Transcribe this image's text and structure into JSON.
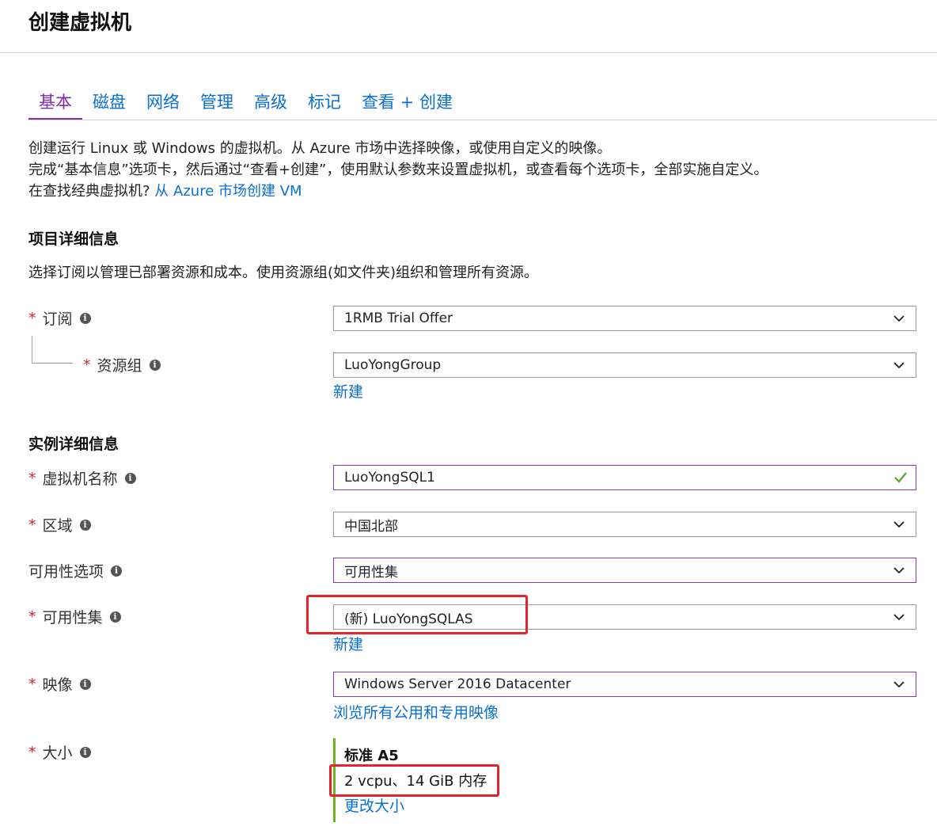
{
  "page": {
    "title": "创建虚拟机"
  },
  "tabs": [
    {
      "label": "基本",
      "active": true
    },
    {
      "label": "磁盘",
      "active": false
    },
    {
      "label": "网络",
      "active": false
    },
    {
      "label": "管理",
      "active": false
    },
    {
      "label": "高级",
      "active": false
    },
    {
      "label": "标记",
      "active": false
    },
    {
      "label": "查看 + 创建",
      "active": false
    }
  ],
  "intro": {
    "line1": "创建运行 Linux 或 Windows 的虚拟机。从 Azure 市场中选择映像，或使用自定义的映像。",
    "line2": "完成“基本信息”选项卡，然后通过“查看+创建”，使用默认参数来设置虚拟机，或查看每个选项卡，全部实施自定义。",
    "line3_text": "在查找经典虚拟机?",
    "line3_link": "从 Azure 市场创建 VM"
  },
  "project": {
    "heading": "项目详细信息",
    "description": "选择订阅以管理已部署资源和成本。使用资源组(如文件夹)组织和管理所有资源。",
    "subscription": {
      "label": "订阅",
      "value": "1RMB Trial Offer"
    },
    "resource_group": {
      "label": "资源组",
      "value": "LuoYongGroup",
      "new_link": "新建"
    }
  },
  "instance": {
    "heading": "实例详细信息",
    "vm_name": {
      "label": "虚拟机名称",
      "value": "LuoYongSQL1"
    },
    "region": {
      "label": "区域",
      "value": "中国北部"
    },
    "availability_options": {
      "label": "可用性选项",
      "value": "可用性集"
    },
    "availability_set": {
      "label": "可用性集",
      "value": "(新) LuoYongSQLAS",
      "new_link": "新建"
    },
    "image": {
      "label": "映像",
      "value": "Windows Server 2016 Datacenter",
      "browse_link": "浏览所有公用和专用映像"
    },
    "size": {
      "label": "大小",
      "name": "标准 A5",
      "spec": "2 vcpu、14 GiB 内存",
      "change_link": "更改大小"
    }
  },
  "colors": {
    "accent": "#7e2ea9",
    "link": "#0a6fd1",
    "required": "#c4262e",
    "highlight": "#e3242b",
    "valid": "#4aa52e",
    "size_bar": "#6fb325"
  },
  "icons": {
    "info": "info-icon",
    "dropdown": "chevron-down-icon",
    "valid": "checkmark-icon"
  },
  "info_glyph": "i"
}
